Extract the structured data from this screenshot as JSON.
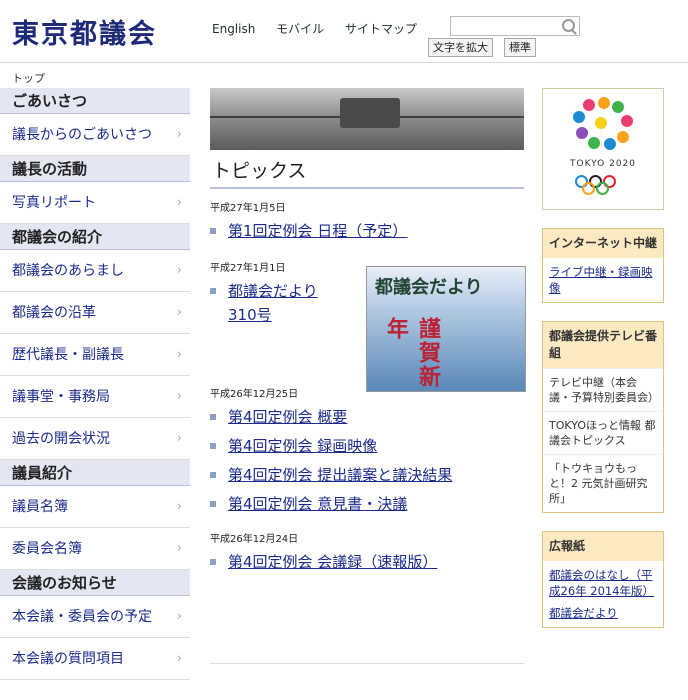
{
  "header": {
    "site_title": "東京都議会",
    "links": [
      "English",
      "モバイル",
      "サイトマップ"
    ],
    "search_placeholder": "",
    "font_buttons": [
      "文字を拡大",
      "標準"
    ]
  },
  "breadcrumb": "トップ",
  "sidebar": {
    "sections": [
      {
        "heading": "ごあいさつ",
        "items": [
          "議長からのごあいさつ"
        ]
      },
      {
        "heading": "議長の活動",
        "items": [
          "写真リポート"
        ]
      },
      {
        "heading": "都議会の紹介",
        "items": [
          "都議会のあらまし",
          "都議会の沿革",
          "歴代議長・副議長",
          "議事堂・事務局",
          "過去の開会状況"
        ]
      },
      {
        "heading": "議員紹介",
        "items": [
          "議員名簿",
          "委員会名簿"
        ]
      },
      {
        "heading": "会議のお知らせ",
        "items": [
          "本会議・委員会の予定",
          "本会議の質問項目"
        ]
      }
    ]
  },
  "main": {
    "topics_title": "トピックス",
    "groups": [
      {
        "date": "平成27年1月5日",
        "items": [
          "第1回定例会 日程（予定）"
        ]
      },
      {
        "date": "平成27年1月1日",
        "items": [
          "都議会だより 310号"
        ]
      },
      {
        "date": "平成26年12月25日",
        "items": [
          "第4回定例会 概要",
          "第4回定例会 録画映像",
          "第4回定例会 提出議案と議決結果",
          "第4回定例会 意見書・決議"
        ]
      },
      {
        "date": "平成26年12月24日",
        "items": [
          "第4回定例会 会議録（速報版）"
        ]
      }
    ],
    "promo": {
      "title": "都議会だより",
      "text": "謹賀新年"
    }
  },
  "right": {
    "logo_text": "TOKYO 2020",
    "internet": {
      "heading": "インターネット中継",
      "link": "ライブ中継・録画映像"
    },
    "tv": {
      "heading": "都議会提供テレビ番組",
      "blocks": [
        "テレビ中継（本会議・予算特別委員会）",
        "TOKYOほっと情報 都議会トピックス",
        "「トウキョウもっと！2 元気計画研究所」"
      ]
    },
    "pr": {
      "heading": "広報紙",
      "links": [
        "都議会のはなし（平成26年 2014年版）",
        "都議会だより"
      ]
    }
  },
  "colors": {
    "title_navy": "#1e2a78",
    "link_blue": "#1a2b8c",
    "side_heading_bg": "#e4e6f2",
    "panel_head_bg": "#fbe9c2"
  }
}
